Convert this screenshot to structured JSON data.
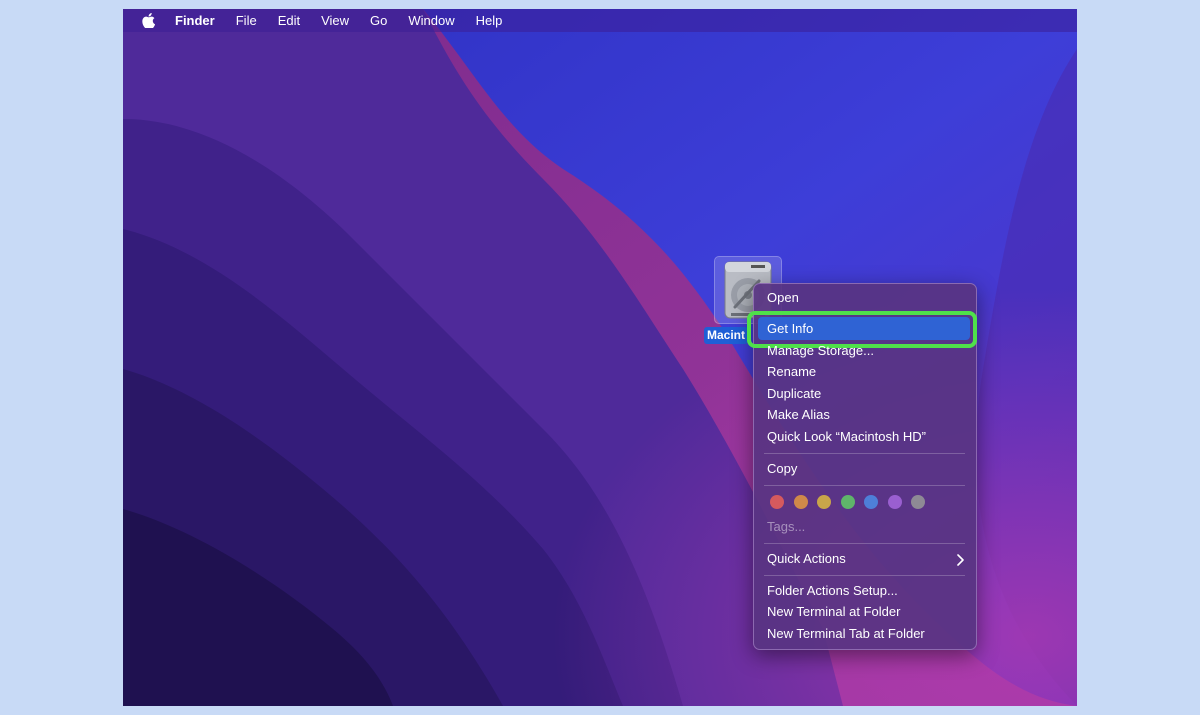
{
  "menubar": {
    "app_name": "Finder",
    "items": [
      "File",
      "Edit",
      "View",
      "Go",
      "Window",
      "Help"
    ]
  },
  "desktop": {
    "disk_icon": "hard-drive-icon",
    "disk_label": "Macint"
  },
  "context_menu": {
    "open": "Open",
    "get_info": "Get Info",
    "manage_storage": "Manage Storage...",
    "rename": "Rename",
    "duplicate": "Duplicate",
    "make_alias": "Make Alias",
    "quick_look": "Quick Look “Macintosh HD”",
    "copy": "Copy",
    "tag_colors": [
      "#d55a5e",
      "#d0894a",
      "#c9a54a",
      "#5fb56a",
      "#4e7fd8",
      "#9a5fd0",
      "#8e8a95"
    ],
    "tags_placeholder": "Tags...",
    "quick_actions": "Quick Actions",
    "folder_actions_setup": "Folder Actions Setup...",
    "new_terminal": "New Terminal at Folder",
    "new_terminal_tab": "New Terminal Tab at Folder"
  },
  "colors": {
    "highlight": "#2f63d4",
    "annotation_ring": "#4fe04a"
  }
}
